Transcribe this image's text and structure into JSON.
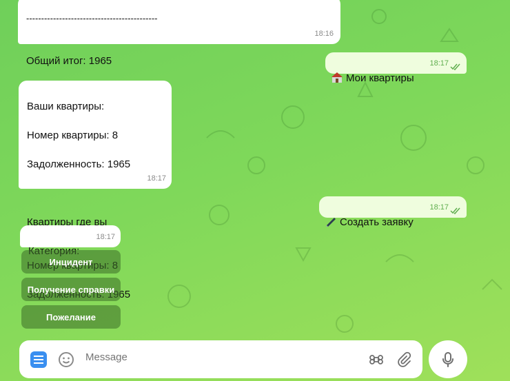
{
  "messages": {
    "m1": {
      "divider": "--------------------------------------------",
      "text": "Общий итог: 1965",
      "time": "18:16"
    },
    "m2": {
      "emoji": "house-emoji",
      "text": "Мои квартиры",
      "time": "18:17"
    },
    "m3": {
      "lines": [
        "Ваши квартиры:",
        "Номер квартиры: 8",
        "Задолженность: 1965",
        "",
        "Квартиры где вы живете:",
        "Номер квартиры: 8",
        "Задолженность: 1965"
      ],
      "time": "18:17"
    },
    "m4": {
      "emoji": "pen-emoji",
      "text": "Создать заявку",
      "time": "18:17"
    },
    "m5": {
      "text": "Категория:",
      "time": "18:17"
    }
  },
  "keyboard": {
    "buttons": [
      "Инцидент",
      "Получение справки",
      "Пожелание"
    ]
  },
  "composer": {
    "placeholder": "Message"
  },
  "colors": {
    "bubble_in": "#ffffff",
    "bubble_out": "#effdde",
    "accent": "#3a8ff0",
    "read_check": "#5fae4e"
  }
}
